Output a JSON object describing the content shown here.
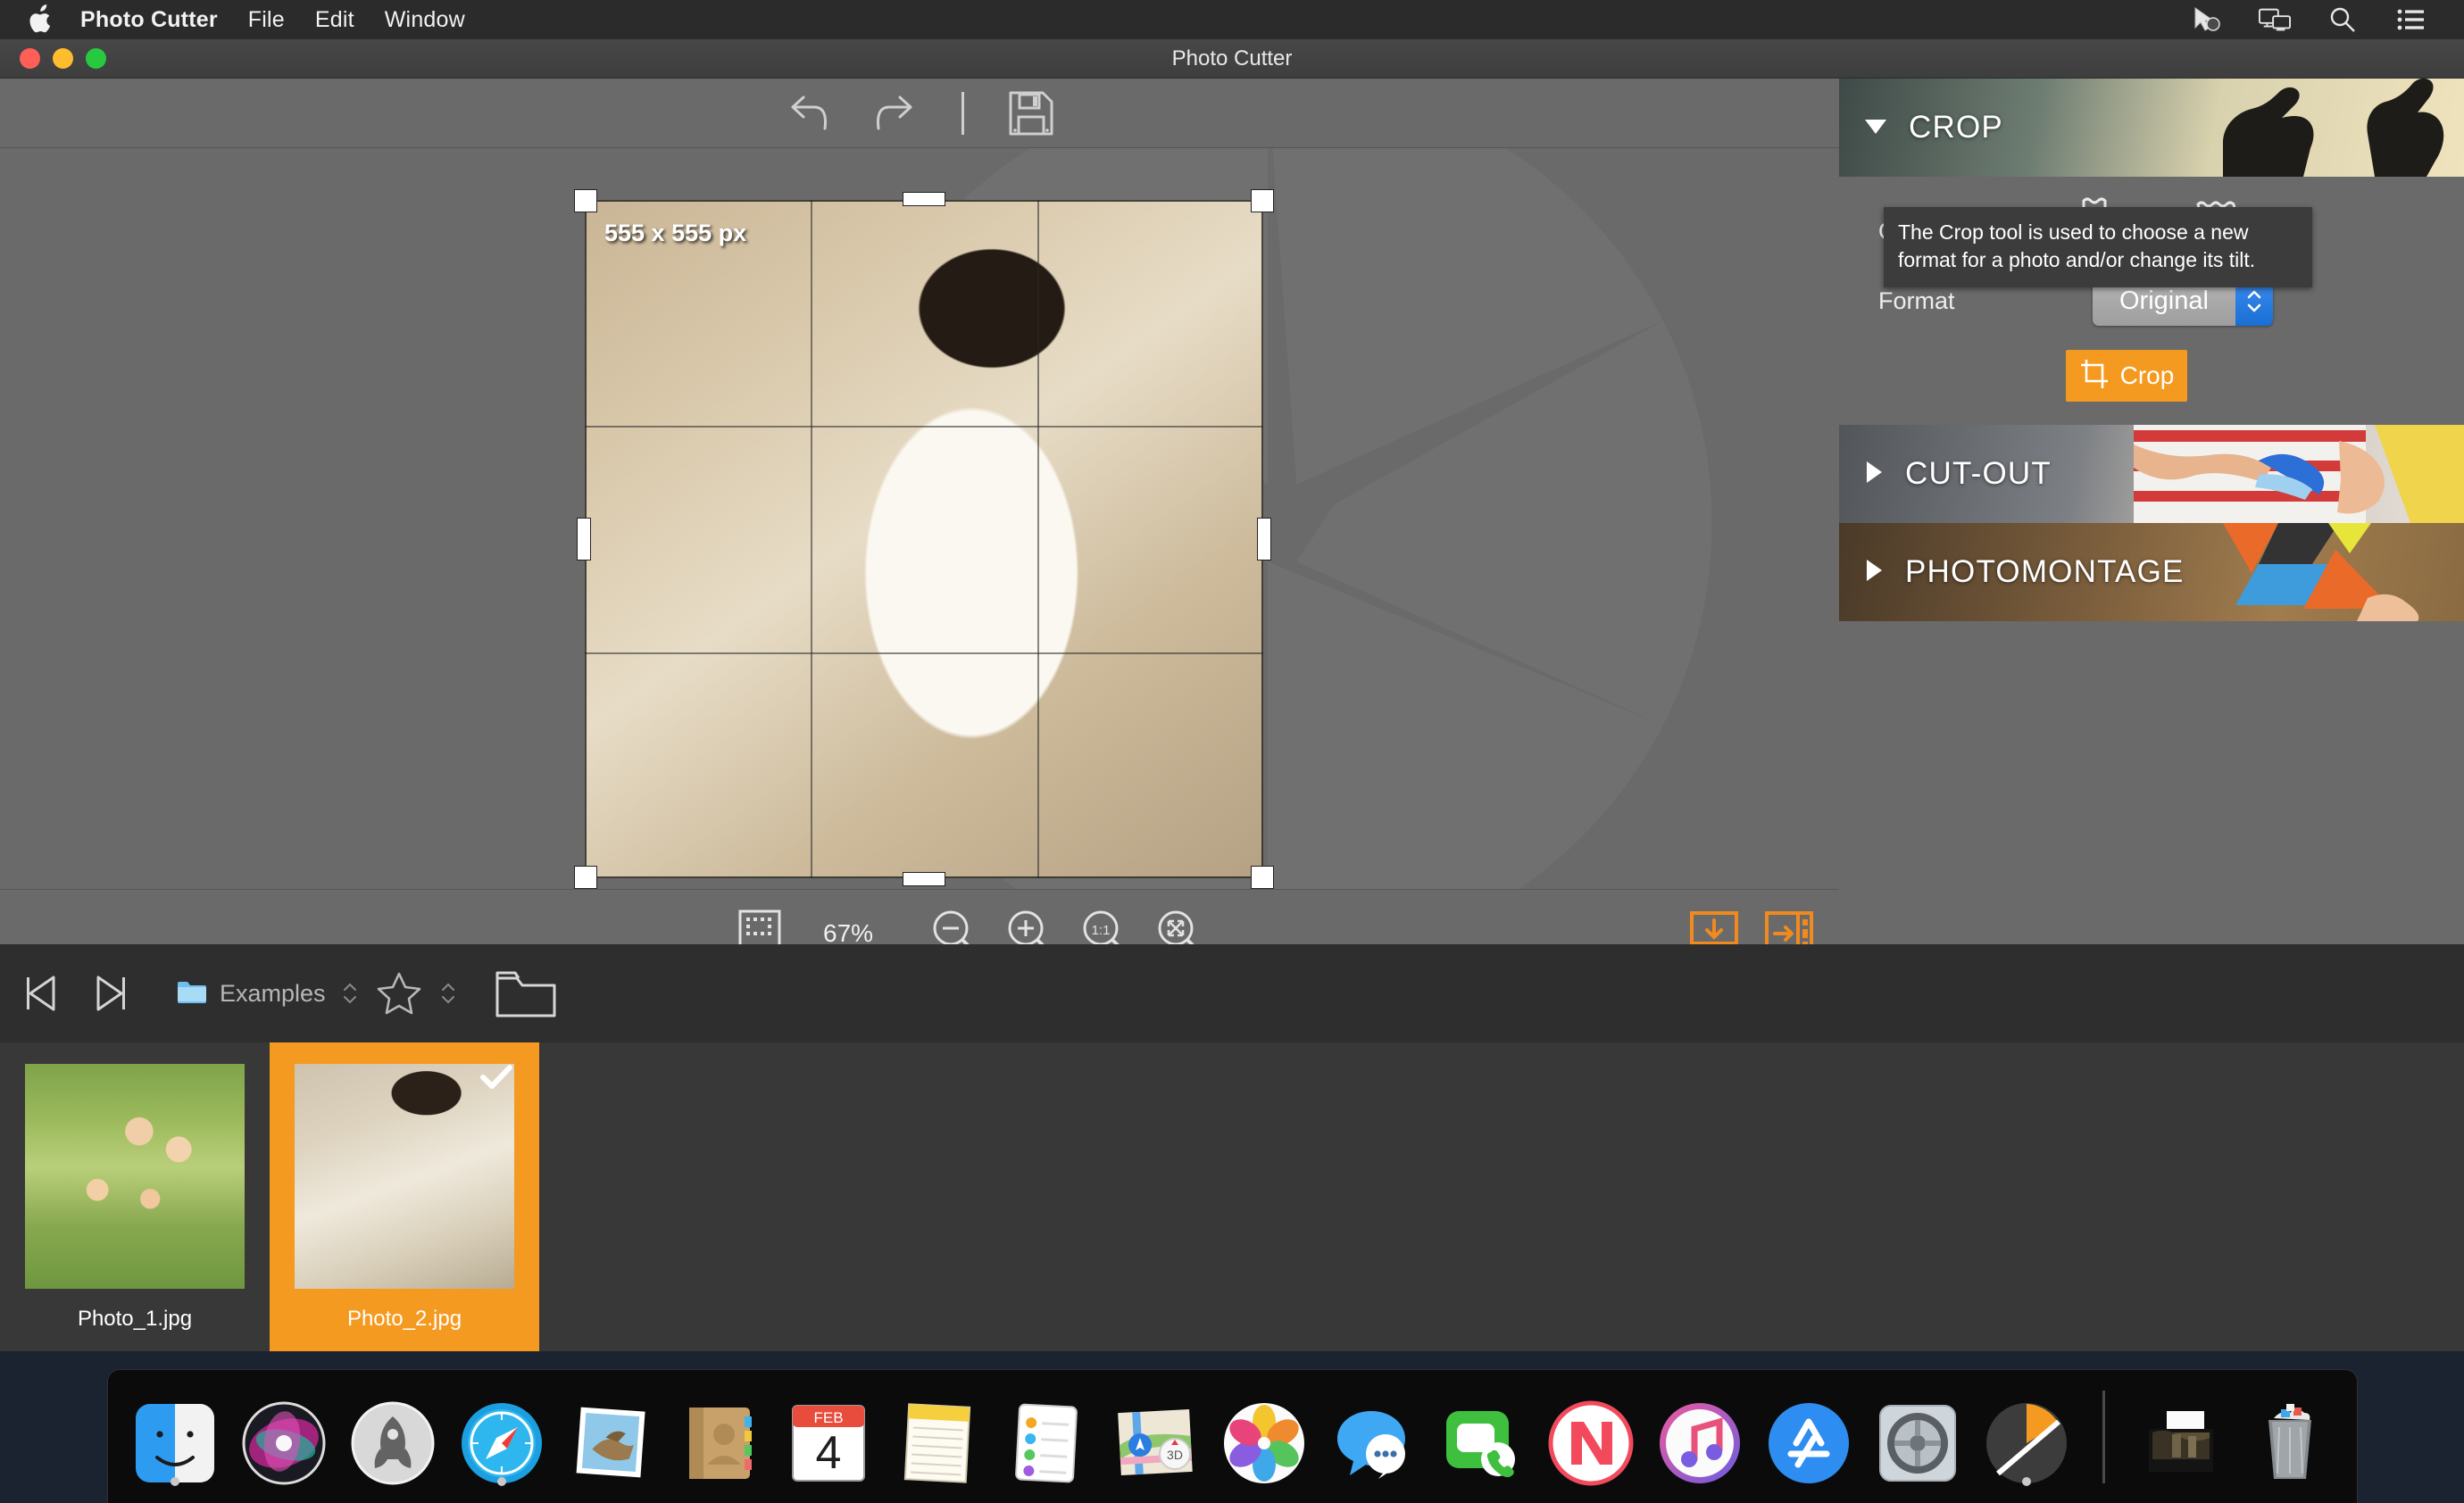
{
  "menubar": {
    "apple_icon": "apple-logo-icon",
    "app_name": "Photo Cutter",
    "items": [
      "File",
      "Edit",
      "Window"
    ],
    "right_icons": [
      "pointer-icon",
      "screen-mirroring-icon",
      "search-icon",
      "control-center-icon"
    ]
  },
  "window": {
    "title": "Photo Cutter",
    "traffic_lights": {
      "close": "close-button",
      "minimize": "minimize-button",
      "zoom": "zoom-button"
    }
  },
  "toolbar": {
    "undo": "undo-icon",
    "redo": "redo-icon",
    "save": "save-floppy-icon"
  },
  "canvas": {
    "crop_size_label": "555 x 555 px",
    "watermark": "aperture-watermark"
  },
  "statusbar": {
    "frame_icon": "selection-frame-icon",
    "zoom_percent": "67%",
    "zoom_out": "zoom-out-icon",
    "zoom_in": "zoom-in-icon",
    "zoom_actual": "1:1",
    "zoom_fit": "fit-to-window-icon",
    "export_save": "save-to-disk-icon",
    "export_share": "send-to-panel-icon"
  },
  "tooltip": {
    "text": "The Crop tool is used to choose a new format for a photo and/or change its tilt."
  },
  "panel": {
    "sections": [
      {
        "title": "CROP",
        "expanded": true,
        "arrow": "triangle-down-icon"
      },
      {
        "title": "CUT-OUT",
        "expanded": false,
        "arrow": "triangle-right-icon"
      },
      {
        "title": "PHOTOMONTAGE",
        "expanded": false,
        "arrow": "triangle-right-icon"
      }
    ],
    "crop": {
      "orientation_label": "Orientation",
      "orientation_options": [
        {
          "name": "portrait",
          "selected": true
        },
        {
          "name": "landscape",
          "selected": false
        }
      ],
      "format_label": "Format",
      "format_value": "Original",
      "crop_button_label": "Crop",
      "accent_color": "#f59a20"
    }
  },
  "browser": {
    "prev": "previous-image-icon",
    "next": "next-image-icon",
    "folder_icon": "blue-folder-icon",
    "folder_name": "Examples",
    "star": "favorite-star-icon",
    "open_folder": "open-folder-icon"
  },
  "thumbnails": [
    {
      "label": "Photo_1.jpg",
      "selected": false,
      "style": "family"
    },
    {
      "label": "Photo_2.jpg",
      "selected": true,
      "style": "bride",
      "check": "checkmark-icon"
    }
  ],
  "dock": {
    "items": [
      {
        "name": "finder",
        "running": true
      },
      {
        "name": "siri",
        "running": false
      },
      {
        "name": "launchpad",
        "running": false
      },
      {
        "name": "safari",
        "running": true
      },
      {
        "name": "mail",
        "running": false
      },
      {
        "name": "contacts",
        "running": false
      },
      {
        "name": "calendar",
        "running": false,
        "month": "FEB",
        "day": "4"
      },
      {
        "name": "notes",
        "running": false
      },
      {
        "name": "reminders",
        "running": false
      },
      {
        "name": "maps",
        "running": false,
        "badge": "3D"
      },
      {
        "name": "photos",
        "running": false
      },
      {
        "name": "messages",
        "running": false
      },
      {
        "name": "facetime",
        "running": false
      },
      {
        "name": "news",
        "running": false
      },
      {
        "name": "itunes",
        "running": false
      },
      {
        "name": "app-store",
        "running": false
      },
      {
        "name": "system-preferences",
        "running": false
      },
      {
        "name": "photo-cutter",
        "running": true
      }
    ],
    "right_items": [
      {
        "name": "downloads-stack"
      },
      {
        "name": "trash"
      }
    ]
  }
}
